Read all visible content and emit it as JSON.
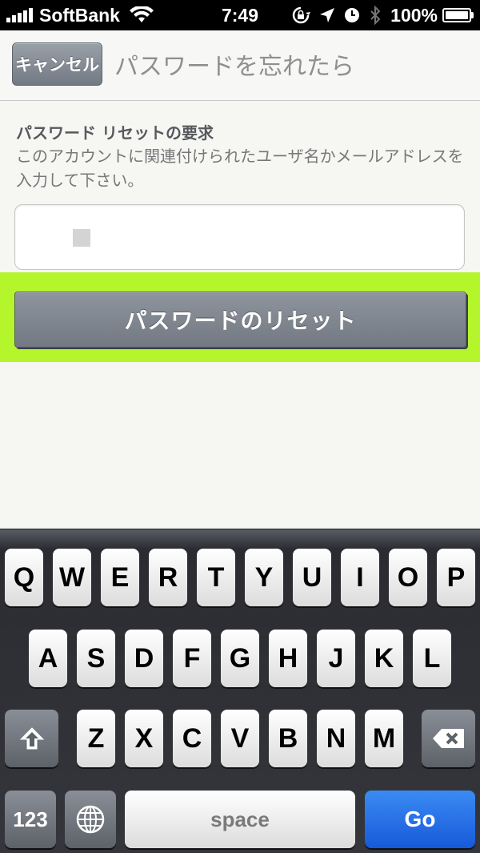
{
  "status_bar": {
    "carrier": "SoftBank",
    "time": "7:49",
    "battery": "100%",
    "icons": [
      "signal-icon",
      "wifi-icon",
      "rotation-lock-icon",
      "location-icon",
      "alarm-icon",
      "bluetooth-icon",
      "battery-icon"
    ]
  },
  "navbar": {
    "cancel_label": "キャンセル",
    "title": "パスワードを忘れたら"
  },
  "form": {
    "section_title": "パスワード リセットの要求",
    "description": "このアカウントに関連付けられたユーザ名かメールアドレスを入力して下さい。",
    "input_value": "",
    "reset_button_label": "パスワードのリセット",
    "highlight_color": "#b5f52c"
  },
  "keyboard": {
    "row1": [
      "Q",
      "W",
      "E",
      "R",
      "T",
      "Y",
      "U",
      "I",
      "O",
      "P"
    ],
    "row2": [
      "A",
      "S",
      "D",
      "F",
      "G",
      "H",
      "J",
      "K",
      "L"
    ],
    "row3": [
      "Z",
      "X",
      "C",
      "V",
      "B",
      "N",
      "M"
    ],
    "numbers_label": "123",
    "space_label": "space",
    "go_label": "Go",
    "icons": [
      "shift-icon",
      "backspace-icon",
      "globe-icon"
    ],
    "go_color": "#1f6ae6"
  }
}
